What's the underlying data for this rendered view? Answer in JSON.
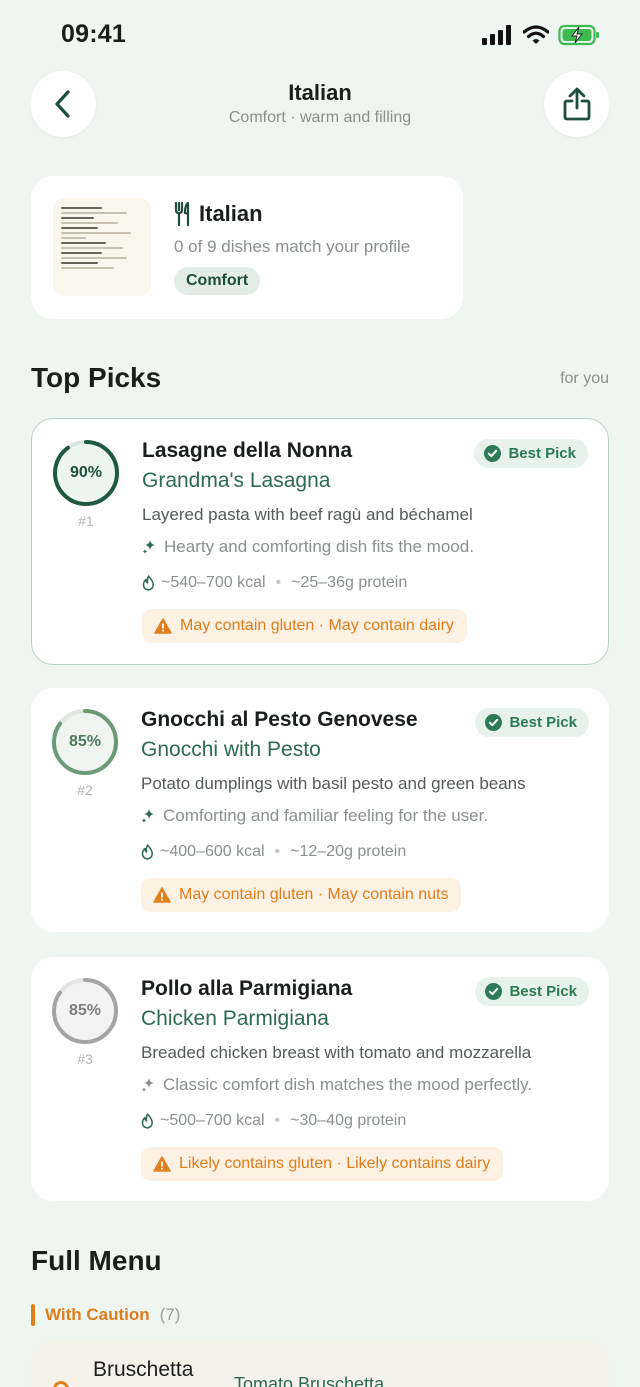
{
  "status_bar": {
    "time": "09:41"
  },
  "header": {
    "title": "Italian",
    "subtitle": "Comfort · warm and filling"
  },
  "restaurant": {
    "name": "Italian",
    "match_text": "0 of 9 dishes match your profile",
    "tag": "Comfort"
  },
  "top_picks": {
    "title": "Top Picks",
    "side_label": "for you",
    "items": [
      {
        "score": "90%",
        "score_fraction": 0.9,
        "rank": "#1",
        "name": "Lasagne della Nonna",
        "translation": "Grandma's Lasagna",
        "badge": "Best Pick",
        "description": "Layered pasta with beef ragù and béchamel",
        "reason": "Hearty and comforting dish fits the mood.",
        "calories": "~540–700 kcal",
        "protein": "~25–36g protein",
        "warning": "May contain gluten · May contain dairy"
      },
      {
        "score": "85%",
        "score_fraction": 0.85,
        "rank": "#2",
        "name": "Gnocchi al Pesto Genovese",
        "translation": "Gnocchi with Pesto",
        "badge": "Best Pick",
        "description": "Potato dumplings with basil pesto and green beans",
        "reason": "Comforting and familiar feeling for the user.",
        "calories": "~400–600 kcal",
        "protein": "~12–20g protein",
        "warning": "May contain gluten · May contain nuts"
      },
      {
        "score": "85%",
        "score_fraction": 0.85,
        "rank": "#3",
        "name": "Pollo alla Parmigiana",
        "translation": "Chicken Parmigiana",
        "badge": "Best Pick",
        "description": "Breaded chicken breast with tomato and mozzarella",
        "reason": "Classic comfort dish matches the mood perfectly.",
        "calories": "~500–700 kcal",
        "protein": "~30–40g protein",
        "warning": "Likely contains gluten · Likely contains dairy"
      }
    ]
  },
  "full_menu": {
    "title": "Full Menu",
    "group_label": "With Caution",
    "group_count": "(7)",
    "first_item": {
      "name": "Bruschetta",
      "translation": "Tomato Bruschetta"
    }
  },
  "colors": {
    "background": "#eff5f1",
    "accent_green": "#2c6b4f",
    "warning_orange": "#de7d1a"
  }
}
